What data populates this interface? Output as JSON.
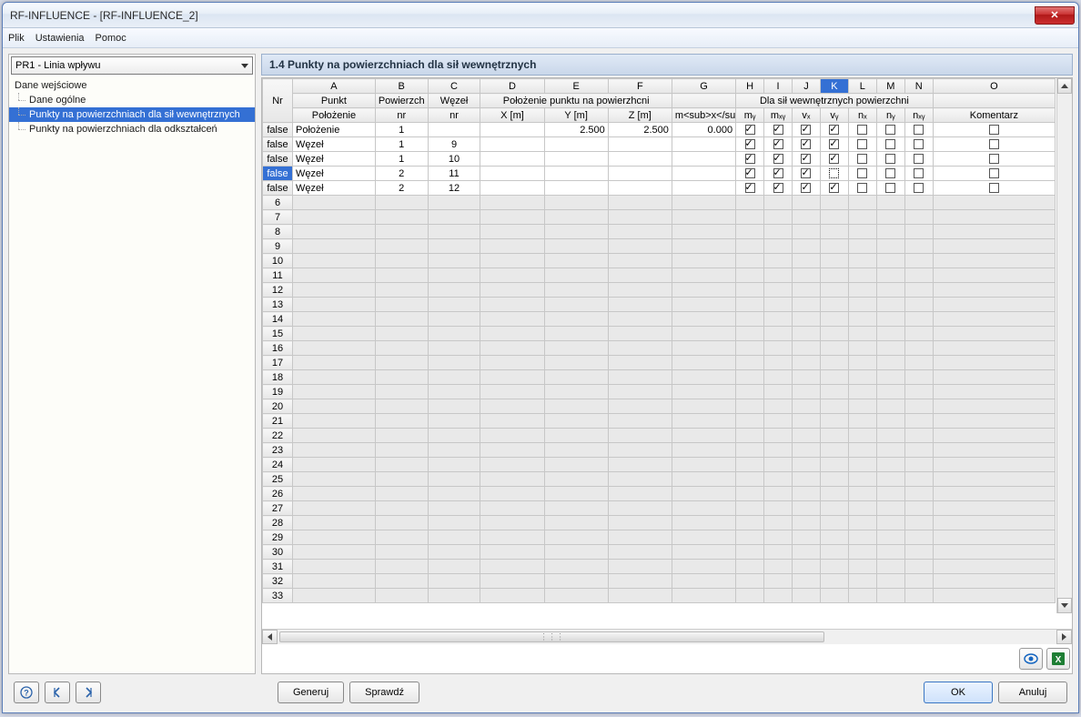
{
  "window": {
    "title": "RF-INFLUENCE - [RF-INFLUENCE_2]"
  },
  "menu": {
    "file": "Plik",
    "settings": "Ustawienia",
    "help": "Pomoc"
  },
  "combo": {
    "selected": "PR1 - Linia wpływu"
  },
  "tree": {
    "root": "Dane wejściowe",
    "items": [
      "Dane ogólne",
      "Punkty na powierzchniach dla sił wewnętrznych",
      "Punkty na powierzchniach dla odkształceń"
    ],
    "selectedIndex": 1
  },
  "sectionTitle": "1.4 Punkty na powierzchniach dla sił wewnętrznych",
  "grid": {
    "colLetters": [
      "A",
      "B",
      "C",
      "D",
      "E",
      "F",
      "G",
      "H",
      "I",
      "J",
      "K",
      "L",
      "M",
      "N",
      "O"
    ],
    "highlightCol": "K",
    "group1": {
      "A": "Punkt",
      "B": "Powierzch",
      "C": "Węzeł"
    },
    "group2Span": "Położenie punktu na powierzhcni",
    "group3Span": "Dla sił wewnętrznych powierzchni",
    "row2": {
      "Nr": "Nr",
      "A": "Położenie",
      "B": "nr",
      "C": "nr",
      "D": "X [m]",
      "E": "Y [m]",
      "F": "Z [m]",
      "G": "m<sub>x</su",
      "H": "mᵧ",
      "I": "mₓᵧ",
      "J": "vₓ",
      "K": "vᵧ",
      "L": "nₓ",
      "M": "nᵧ",
      "N": "nₓᵧ",
      "O": "Komentarz"
    },
    "rows": [
      {
        "n": false,
        "pol": "Położenie",
        "pow": "1",
        "wez": "",
        "x": "",
        "y": "2.500",
        "z": "2.500",
        "g": "0.000",
        "h": true,
        "i": true,
        "j": true,
        "k": true,
        "l": false,
        "m": false,
        "o": false
      },
      {
        "n": false,
        "pol": "Węzeł",
        "pow": "1",
        "wez": "9",
        "x": "",
        "y": "",
        "z": "",
        "g": "",
        "h": true,
        "i": true,
        "j": true,
        "k": true,
        "l": false,
        "m": false,
        "o": false
      },
      {
        "n": false,
        "pol": "Węzeł",
        "pow": "1",
        "wez": "10",
        "x": "",
        "y": "",
        "z": "",
        "g": "",
        "h": true,
        "i": true,
        "j": true,
        "k": true,
        "l": false,
        "m": false,
        "o": false
      },
      {
        "n": false,
        "pol": "Węzeł",
        "pow": "2",
        "wez": "11",
        "x": "",
        "y": "",
        "z": "",
        "g": "",
        "h": true,
        "i": true,
        "j": true,
        "k": false,
        "kdot": true,
        "l": false,
        "m": false,
        "o": false,
        "selected": true
      },
      {
        "n": false,
        "pol": "Węzeł",
        "pow": "2",
        "wez": "12",
        "x": "",
        "y": "",
        "z": "",
        "g": "",
        "h": true,
        "i": true,
        "j": true,
        "k": true,
        "l": false,
        "m": false,
        "o": false
      }
    ],
    "emptyRows": 28
  },
  "footer": {
    "generate": "Generuj",
    "check": "Sprawdź",
    "ok": "OK",
    "cancel": "Anuluj"
  }
}
